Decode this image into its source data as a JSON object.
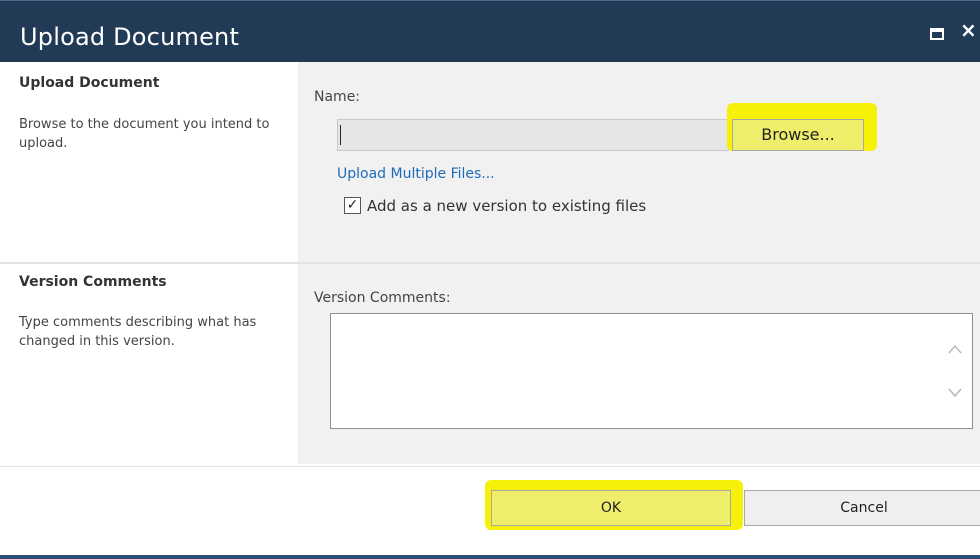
{
  "dialog": {
    "title": "Upload Document",
    "icons": {
      "maximize": "maximize-icon",
      "close": "close-icon"
    },
    "close_glyph": "×"
  },
  "upload_section": {
    "heading": "Upload Document",
    "description": "Browse to the document you intend to upload.",
    "name_label": "Name:",
    "name_value": "",
    "browse_label": "Browse...",
    "upload_multiple_label": "Upload Multiple Files...",
    "add_version_checked": true,
    "add_version_label": "Add as a new version to existing files"
  },
  "version_section": {
    "heading": "Version Comments",
    "description": "Type comments describing what has changed in this version.",
    "comments_label": "Version Comments:",
    "comments_value": ""
  },
  "footer": {
    "ok_label": "OK",
    "cancel_label": "Cancel"
  },
  "colors": {
    "titlebar": "#213a55",
    "link": "#1e6bb8",
    "highlight": "#f7f10a"
  }
}
